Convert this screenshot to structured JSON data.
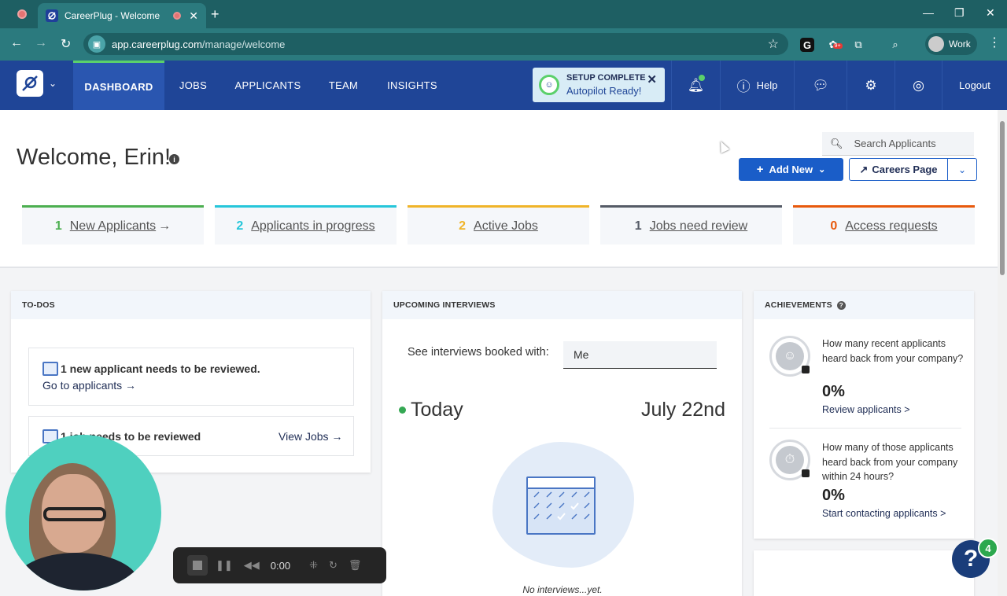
{
  "browser": {
    "tab_title": "CareerPlug - Welcome",
    "url_host": "app.careerplug.com",
    "url_path": "/manage/welcome",
    "profile_name": "Work",
    "ext_badge": "9+"
  },
  "nav": {
    "items": [
      {
        "label": "DASHBOARD",
        "active": true
      },
      {
        "label": "JOBS"
      },
      {
        "label": "APPLICANTS"
      },
      {
        "label": "TEAM"
      },
      {
        "label": "INSIGHTS"
      }
    ],
    "setup_title": "SETUP COMPLETE",
    "setup_subtitle": "Autopilot Ready!",
    "help_label": "Help",
    "logout_label": "Logout"
  },
  "page": {
    "welcome": "Welcome, Erin!",
    "search_placeholder": "Search Applicants",
    "add_new_label": "Add New",
    "careers_label": "Careers Page"
  },
  "stats": [
    {
      "count": "1",
      "label": "New Applicants",
      "arrow": "→",
      "color": "#4caf50"
    },
    {
      "count": "2",
      "label": "Applicants in progress",
      "arrow": "",
      "color": "#26c6da"
    },
    {
      "count": "2",
      "label": "Active Jobs",
      "arrow": "",
      "color": "#f0b429"
    },
    {
      "count": "1",
      "label": "Jobs need review",
      "arrow": "",
      "color": "#555b66"
    },
    {
      "count": "0",
      "label": "Access requests",
      "arrow": "",
      "color": "#e8590c"
    }
  ],
  "todos": {
    "header": "TO-DOS",
    "item1_title": "1 new applicant needs to be reviewed.",
    "item1_link": "Go to applicants →",
    "item2_title": "1 job needs to be reviewed",
    "item2_link": "View Jobs →"
  },
  "interviews": {
    "header": "UPCOMING INTERVIEWS",
    "booked_with_label": "See interviews booked with:",
    "booked_with_value": "Me",
    "today_label": "Today",
    "date_label": "July 22nd",
    "empty_text": "No interviews...yet."
  },
  "achievements": {
    "header": "ACHIEVEMENTS",
    "q1": "How many recent applicants heard back from your company?",
    "q1_pct": "0%",
    "q1_link": "Review applicants >",
    "q2": "How many of those applicants heard back from your company within 24 hours?",
    "q2_pct": "0%",
    "q2_link": "Start contacting applicants >"
  },
  "recorder": {
    "time": "0:00"
  },
  "help_widget": {
    "badge": "4"
  }
}
